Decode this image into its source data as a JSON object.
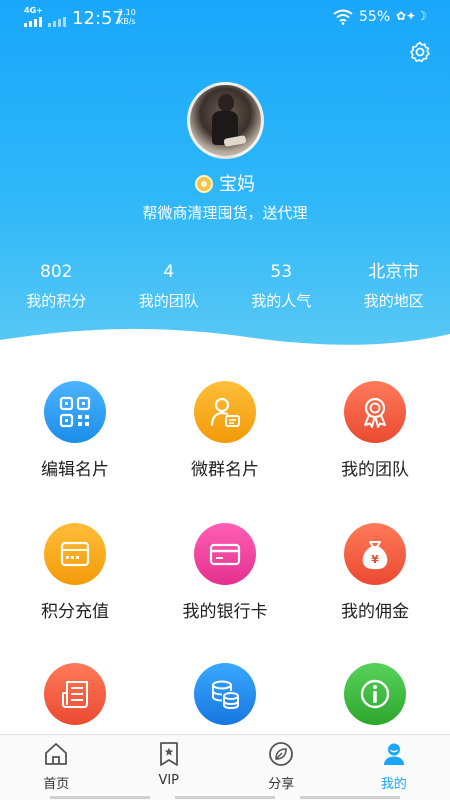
{
  "status_bar": {
    "network": "4G+",
    "time": "12:57",
    "speed_value": "2.10",
    "speed_unit": "KB/s",
    "battery": "55%"
  },
  "profile": {
    "nickname": "宝妈",
    "signature": "帮微商清理囤货，送代理"
  },
  "stats": [
    {
      "value": "802",
      "label": "我的积分"
    },
    {
      "value": "4",
      "label": "我的团队"
    },
    {
      "value": "53",
      "label": "我的人气"
    },
    {
      "value": "北京市",
      "label": "我的地区"
    }
  ],
  "grid": [
    {
      "label": "编辑名片",
      "icon": "qr-code-icon",
      "color": "#2f9cf0"
    },
    {
      "label": "微群名片",
      "icon": "user-card-icon",
      "color": "#f5a30f"
    },
    {
      "label": "我的团队",
      "icon": "award-icon",
      "color": "#f0563b"
    },
    {
      "label": "积分充值",
      "icon": "wallet-card-icon",
      "color": "#f5a40e"
    },
    {
      "label": "我的银行卡",
      "icon": "bank-card-icon",
      "color": "#ef3e9b"
    },
    {
      "label": "我的佣金",
      "icon": "money-bag-icon",
      "color": "#f0553a"
    },
    {
      "label": "",
      "icon": "news-icon",
      "color": "#f0503a"
    },
    {
      "label": "",
      "icon": "coin-stack-icon",
      "color": "#1d8ff0"
    },
    {
      "label": "",
      "icon": "info-icon",
      "color": "#3cba3c"
    }
  ],
  "tabs": [
    {
      "label": "首页",
      "icon": "home-icon"
    },
    {
      "label": "VIP",
      "icon": "bookmark-star-icon"
    },
    {
      "label": "分享",
      "icon": "leaf-icon"
    },
    {
      "label": "我的",
      "icon": "user-icon",
      "active": true
    }
  ],
  "colors": {
    "accent": "#1aa7fb",
    "header_top": "#1aa7fb",
    "header_bottom": "#5ccaf4"
  }
}
